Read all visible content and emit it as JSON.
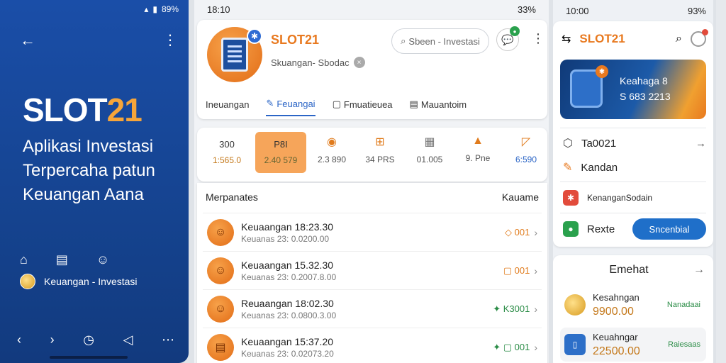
{
  "left": {
    "status": "89%",
    "brand_main": "SLOT",
    "brand_accent": "21",
    "tagline": "Aplikasi Investasi Terpercaha patun Keuangan Aana",
    "sub_label": "Keuangan - Investasi",
    "icons": [
      "home-icon",
      "document-icon",
      "user-icon"
    ],
    "nav_icons": [
      "back-arrow-icon",
      "forward-arrow-icon",
      "clock-icon",
      "triangle-back-icon",
      "more-icon"
    ]
  },
  "mid": {
    "time": "18:10",
    "battery": "33%",
    "app_name": "SLOT21",
    "app_sub": "Skuangan- Sbodac",
    "search_placeholder": "Sbeen - Investasi",
    "tabs": [
      "Ineuangan",
      "Feuangai",
      "Fmuatieuea",
      "Mauantoim"
    ],
    "quick": [
      {
        "v1": "300",
        "v2": "1:565.0"
      },
      {
        "v1": "P8I",
        "v2": "2.40 579"
      },
      {
        "v1": "",
        "v2": "2.3 890"
      },
      {
        "v1": "",
        "v2": "34 PRS"
      },
      {
        "v1": "",
        "v2": "01.005"
      },
      {
        "v1": "",
        "v2": "9. Pne"
      },
      {
        "v1": "",
        "v2": "6:590"
      }
    ],
    "list_title": "Merpanates",
    "list_action": "Kauame",
    "rows": [
      {
        "t1": "Keuaangan 18:23.30",
        "t2": "Keuanas 23: 0.0200.00",
        "amt": "001"
      },
      {
        "t1": "Keuaangan 15.32.30",
        "t2": "Keuanas 23: 0.2007.8.00",
        "amt": "001"
      },
      {
        "t1": "Reuaangan 18:02.30",
        "t2": "Keuanas 23: 0.0800.3.00",
        "amt": "K3001"
      },
      {
        "t1": "Keuaangan 15:37.20",
        "t2": "Keuanas 23: 0.02073.20",
        "amt": "001"
      }
    ]
  },
  "right": {
    "time": "10:00",
    "battery": "93%",
    "title": "SLOT21",
    "banner_l1": "Keahaga 8",
    "banner_l2": "S 683 2213",
    "items": [
      "Ta0021",
      "Kandan",
      "KenanganSodain",
      "Rexte"
    ],
    "button": "Sncenbial",
    "bottom_title": "Emehat",
    "wallets": [
      {
        "name": "Kesahngan",
        "value": "9900.00",
        "status": "Nanadaai"
      },
      {
        "name": "Keuahngar",
        "value": "22500.00",
        "status": "Raiesaas"
      }
    ]
  },
  "colors": {
    "brand_blue": "#1a4ea8",
    "brand_orange": "#e8791f",
    "accent_green": "#2a8c46"
  }
}
